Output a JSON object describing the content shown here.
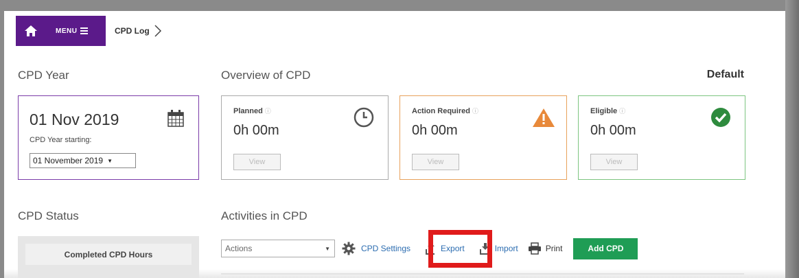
{
  "header": {
    "menu_label": "MENU",
    "breadcrumb": "CPD Log"
  },
  "cpd_year": {
    "title": "CPD Year",
    "date": "01 Nov 2019",
    "starting_label": "CPD Year starting:",
    "selected_option": "01 November 2019"
  },
  "overview": {
    "title": "Overview of CPD",
    "default_label": "Default",
    "cards": [
      {
        "label": "Planned",
        "value": "0h 00m",
        "view": "View",
        "color": "#aaaaaa",
        "icon": "clock-icon"
      },
      {
        "label": "Action Required",
        "value": "0h 00m",
        "view": "View",
        "color": "#e8a15a",
        "icon": "warning-icon"
      },
      {
        "label": "Eligible",
        "value": "0h 00m",
        "view": "View",
        "color": "#7cc47f",
        "icon": "check-circle-icon"
      }
    ]
  },
  "cpd_status": {
    "title": "CPD Status",
    "completed_label": "Completed CPD Hours"
  },
  "activities": {
    "title": "Activities in CPD",
    "actions_placeholder": "Actions",
    "settings": "CPD Settings",
    "export": "Export",
    "import": "Import",
    "print": "Print",
    "add": "Add CPD"
  },
  "colors": {
    "brand_purple": "#5b1a8a",
    "link_blue": "#2b6cb0",
    "add_green": "#1f9d55",
    "highlight_red": "#e01b1b"
  }
}
